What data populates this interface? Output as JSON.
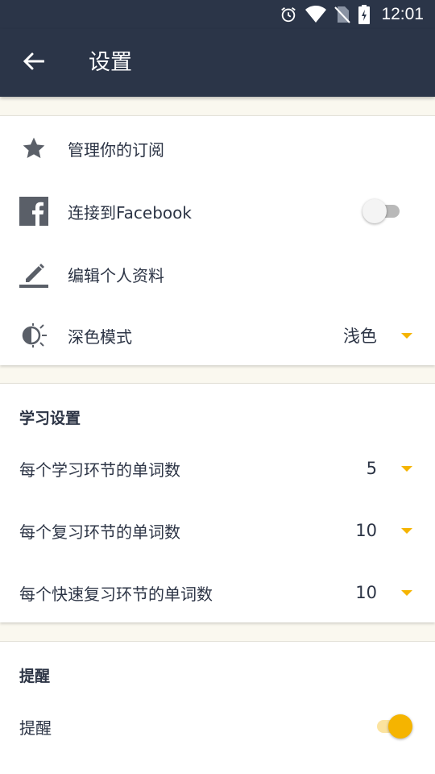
{
  "status_bar": {
    "time": "12:01",
    "icons": [
      "alarm-icon",
      "wifi-icon",
      "no-sim-icon",
      "battery-charging-icon"
    ]
  },
  "toolbar": {
    "title": "设置",
    "back_icon": "arrow-left-icon"
  },
  "account_section": {
    "items": [
      {
        "label": "管理你的订阅",
        "icon": "star-icon"
      },
      {
        "label": "连接到Facebook",
        "icon": "facebook-icon",
        "toggle": false
      },
      {
        "label": "编辑个人资料",
        "icon": "edit-pencil-icon"
      },
      {
        "label": "深色模式",
        "icon": "dark-mode-icon",
        "value": "浅色"
      }
    ]
  },
  "learning_section": {
    "title": "学习设置",
    "items": [
      {
        "label": "每个学习环节的单词数",
        "value": "5"
      },
      {
        "label": "每个复习环节的单词数",
        "value": "10"
      },
      {
        "label": "每个快速复习环节的单词数",
        "value": "10"
      }
    ]
  },
  "reminder_section": {
    "title": "提醒",
    "items": [
      {
        "label": "提醒",
        "toggle": true
      }
    ]
  },
  "colors": {
    "header": "#2b3548",
    "accent": "#f5b400",
    "background": "#faf8ef",
    "text": "#2c3445"
  }
}
